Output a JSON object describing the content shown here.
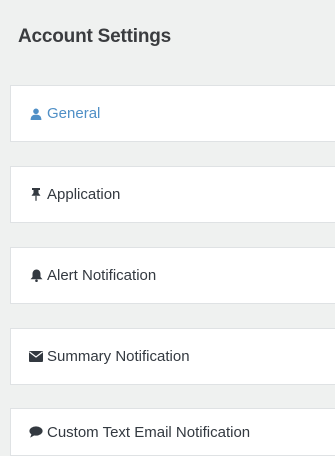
{
  "header": {
    "title": "Account Settings"
  },
  "menu": {
    "active_index": 0,
    "active_color": "#4f8fc6",
    "text_color": "#333940",
    "items": [
      {
        "label": "General",
        "icon": "user-icon"
      },
      {
        "label": "Application",
        "icon": "pin-icon"
      },
      {
        "label": "Alert Notification",
        "icon": "bell-icon"
      },
      {
        "label": "Summary Notification",
        "icon": "envelope-icon"
      },
      {
        "label": "Custom Text Email Notification",
        "icon": "comment-icon"
      }
    ]
  }
}
